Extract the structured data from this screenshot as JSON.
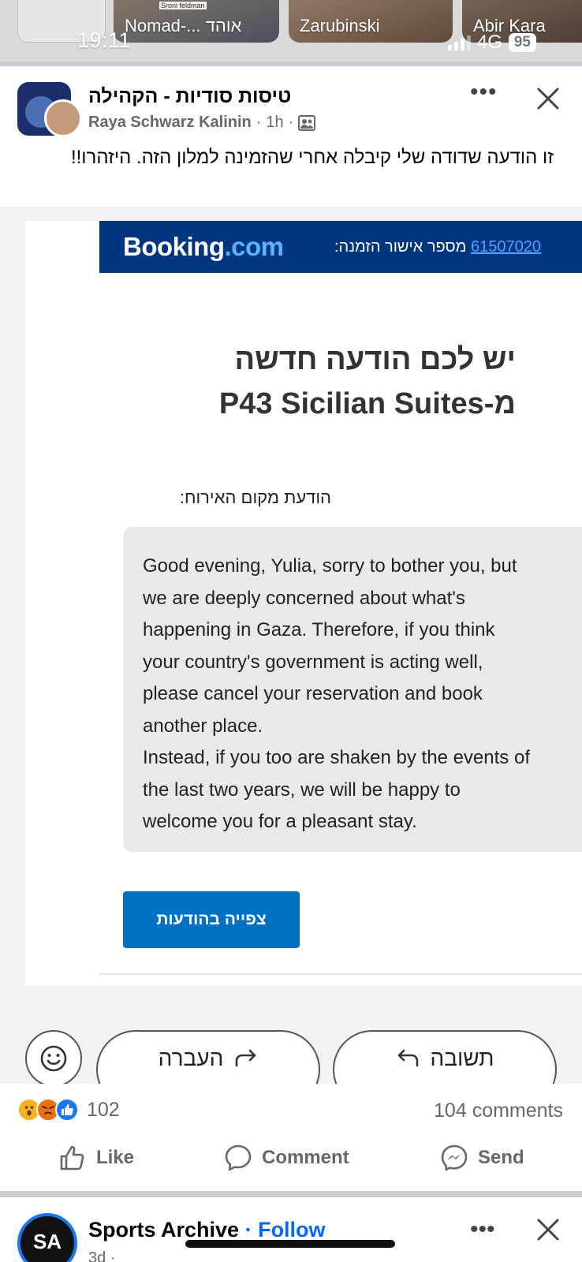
{
  "status_bar": {
    "time": "19:11",
    "network": "4G",
    "battery": "95"
  },
  "stories": [
    {
      "label": "Nomad-... אוהד",
      "overlay": "Sroni feldman"
    },
    {
      "label": "Zarubinski",
      "overlay": ""
    },
    {
      "label": "Abir Kara",
      "overlay": ""
    }
  ],
  "post": {
    "group_name": "טיסות סודיות - הקהילה",
    "author": "Raya Schwarz Kalinin",
    "separator": "·",
    "time": "1h",
    "more_label": "•••",
    "text": "זו הודעה שדודה שלי קיבלה אחרי שהזמינה למלון הזה. היזהרו!!"
  },
  "email": {
    "logo_main": "Booking",
    "logo_suffix": ".com",
    "confirmation_label": "מספר אישור הזמנה:",
    "confirmation_number": "61507020",
    "heading_line1": "יש לכם הודעה חדשה",
    "heading_line2": "מ-P43 Sicilian Suites",
    "host_message_label": "הודעת מקום האירוח:",
    "message": "Good evening, Yulia, sorry to bother you, but\nwe are deeply concerned about what's\nhappening in Gaza. Therefore, if you think\nyour country's government is acting well,\nplease cancel your reservation and book\nanother place.\nInstead, if you too are shaken by the events of\nthe last two years, we will be happy to\nwelcome you for a pleasant stay.",
    "view_button": "צפייה בהודעות",
    "forward_label": "העברה",
    "reply_label": "תשובה"
  },
  "engagement": {
    "reaction_count": "102",
    "comments": "104 comments",
    "like_label": "Like",
    "comment_label": "Comment",
    "send_label": "Send"
  },
  "next_post": {
    "name": "Sports Archive",
    "follow_label": "· Follow",
    "time": "3d ·",
    "avatar_text": "SA"
  },
  "colors": {
    "booking_blue": "#003580",
    "booking_button": "#0071c2",
    "facebook_blue": "#0866ff"
  }
}
